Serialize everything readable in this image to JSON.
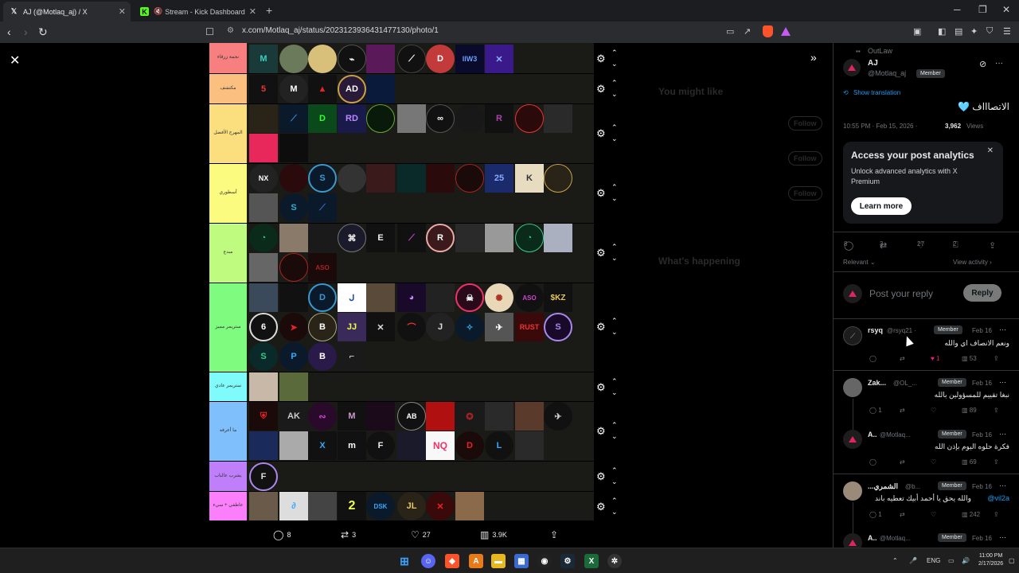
{
  "browser": {
    "tabs": [
      {
        "title": "AJ (@Motlaq_aj) / X",
        "icon": "x-logo-icon"
      },
      {
        "title": "Stream - Kick Dashboard",
        "icon": "kick-logo-icon"
      }
    ],
    "new_tab": "+",
    "url": "x.com/Motlaq_aj/status/2023123936431477130/photo/1"
  },
  "viewer": {
    "tiers": [
      {
        "label": "نجمة زرقاء",
        "color": "#f77f7f"
      },
      {
        "label": "مكتشف",
        "color": "#fbbf7f"
      },
      {
        "label": "المهرج الأفضل",
        "color": "#fbdf7f"
      },
      {
        "label": "أسطوري",
        "color": "#fbfb7f"
      },
      {
        "label": "مبدع",
        "color": "#bffb7f"
      },
      {
        "label": "ستريمر مميز",
        "color": "#7ffb7f"
      },
      {
        "label": "ستريمر عادي",
        "color": "#7ffbfb"
      },
      {
        "label": "ما أعرفه",
        "color": "#7fbffb"
      },
      {
        "label": "يشرب عالباب",
        "color": "#bf7ffb"
      },
      {
        "label": "عاطفي + سيء",
        "color": "#fb7ffb"
      }
    ],
    "icon_labels": {
      "ljw3": "llW3",
      "noa": "NQ",
      "rust": "RUST",
      "skz": "$KZ",
      "k": "K",
      "r": "R",
      "s": "S",
      "nx": "NX",
      "ab": "AB",
      "m": "M",
      "l": "L",
      "x": "X",
      "two": "2"
    },
    "stats": {
      "replies": "8",
      "reposts": "3",
      "likes": "27",
      "views": "3.9K"
    }
  },
  "post": {
    "context": "OutLaw",
    "author_name": "AJ",
    "author_handle": "@Motlaq_aj",
    "member_badge": "Member",
    "show_translation": "Show translation",
    "text": "الاتصاااف 🩵",
    "time": "10:55 PM · Feb 15, 2026 ·",
    "views_count": "3,962",
    "views_label": "Views",
    "analytics": {
      "title": "Access your post analytics",
      "body": "Unlock advanced analytics with X Premium",
      "cta": "Learn more"
    },
    "actions": {
      "replies": "8",
      "reposts": "3",
      "likes": "27",
      "bookmarks": "2"
    },
    "relevant": "Relevant",
    "view_activity": "View activity",
    "reply_placeholder": "Post your reply",
    "reply_button": "Reply"
  },
  "comments": [
    {
      "name": "rsyq",
      "handle": "@rsyq21 ·",
      "badge": "Member",
      "date": "Feb 16",
      "text": "ونعم الانصاف اي والله",
      "likes": "1",
      "views": "53"
    },
    {
      "name": "Zak...",
      "handle": "@OL_...",
      "badge": "Member",
      "date": "Feb 16",
      "text": "نبغا تقييم للمسؤولين بالله",
      "replies": "1",
      "views": "89"
    },
    {
      "name": "A..",
      "handle": "@Motlaq...",
      "badge": "Member",
      "date": "Feb 16",
      "text": "فكرة حلوه اليوم بإذن الله",
      "views": "69"
    },
    {
      "name": "الشمري...",
      "handle": "@b...",
      "badge": "Member",
      "date": "Feb 16",
      "text": "والله يحق يا أحمد أبيك تعطيه باند",
      "mention": "@vil2a",
      "replies": "1",
      "views": "242"
    },
    {
      "name": "A..",
      "handle": "@Motlaq...",
      "badge": "Member",
      "date": "Feb 16"
    }
  ],
  "background_sidebar": {
    "you_might_like": "You might like",
    "whats_happening": "What's happening",
    "follow": "Follow"
  },
  "taskbar": {
    "lang": "ENG",
    "time": "11:00 PM",
    "date": "2/17/2026"
  },
  "colors": {
    "x_blue": "#1d9bf0",
    "like_pink": "#f91880",
    "brave": "#fb542b"
  }
}
